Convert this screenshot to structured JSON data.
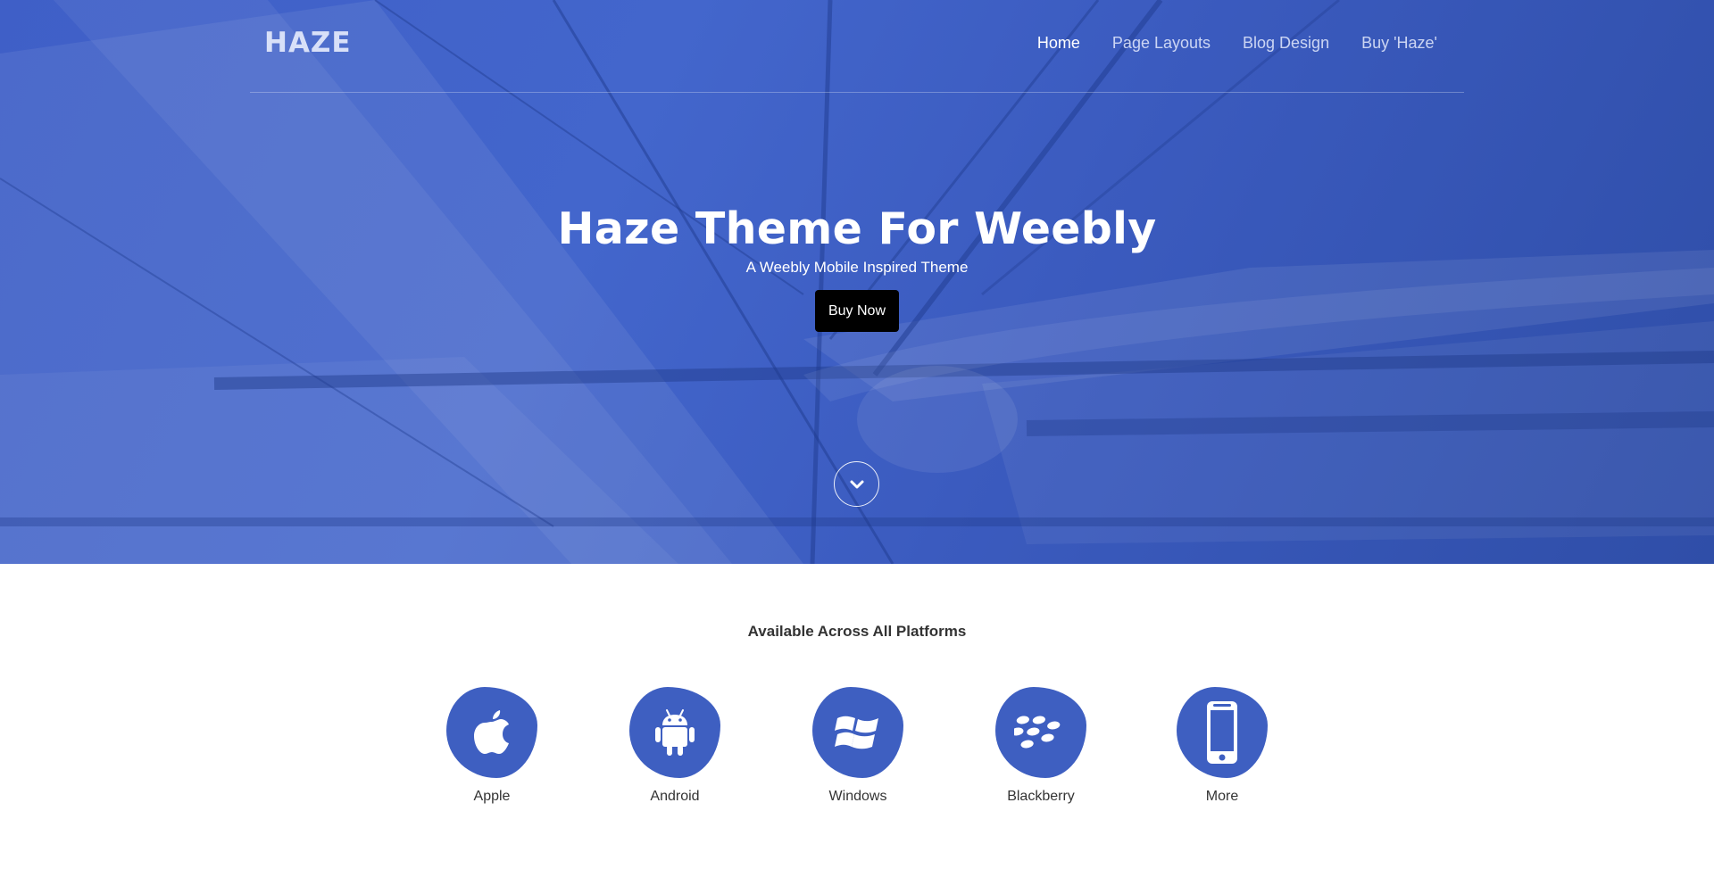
{
  "header": {
    "logo": "HAZE",
    "nav": [
      {
        "label": "Home",
        "active": true
      },
      {
        "label": "Page Layouts",
        "active": false
      },
      {
        "label": "Blog Design",
        "active": false
      },
      {
        "label": "Buy 'Haze'",
        "active": false
      }
    ]
  },
  "hero": {
    "title": "Haze Theme For Weebly",
    "subtitle": "A Weebly Mobile Inspired Theme",
    "cta_label": "Buy Now",
    "scroll_icon": "chevron-down-icon"
  },
  "platforms": {
    "title": "Available Across All Platforms",
    "items": [
      {
        "label": "Apple",
        "icon": "apple-icon"
      },
      {
        "label": "Android",
        "icon": "android-icon"
      },
      {
        "label": "Windows",
        "icon": "windows-icon"
      },
      {
        "label": "Blackberry",
        "icon": "blackberry-icon"
      },
      {
        "label": "More",
        "icon": "mobile-phone-icon"
      }
    ]
  },
  "colors": {
    "hero_overlay": "#3f5fc7",
    "accent": "#3e5fc1",
    "button": "#000000",
    "text_light": "#ffffff"
  }
}
